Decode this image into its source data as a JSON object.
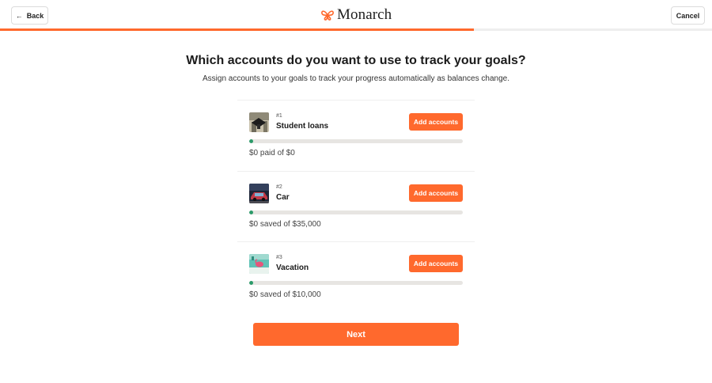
{
  "header": {
    "back_label": "Back",
    "back_icon": "arrow-left-icon",
    "brand_name": "Monarch",
    "brand_icon": "monarch-butterfly-logo",
    "cancel_label": "Cancel",
    "progress_fraction": 0.665
  },
  "page": {
    "title": "Which accounts do you want to use to track your goals?",
    "subtitle": "Assign accounts to your goals to track your progress automatically as balances change."
  },
  "goals": [
    {
      "number": "#1",
      "name": "Student loans",
      "button_label": "Add accounts",
      "amount_text": "$0 paid of $0",
      "progress_fraction": 0.02
    },
    {
      "number": "#2",
      "name": "Car",
      "button_label": "Add accounts",
      "amount_text": "$0 saved of $35,000",
      "progress_fraction": 0.02
    },
    {
      "number": "#3",
      "name": "Vacation",
      "button_label": "Add accounts",
      "amount_text": "$0 saved of $10,000",
      "progress_fraction": 0.02
    }
  ],
  "footer": {
    "next_label": "Next"
  },
  "colors": {
    "accent": "#ff692d",
    "progress_green": "#2b9a69",
    "track": "#e7e5e2"
  }
}
